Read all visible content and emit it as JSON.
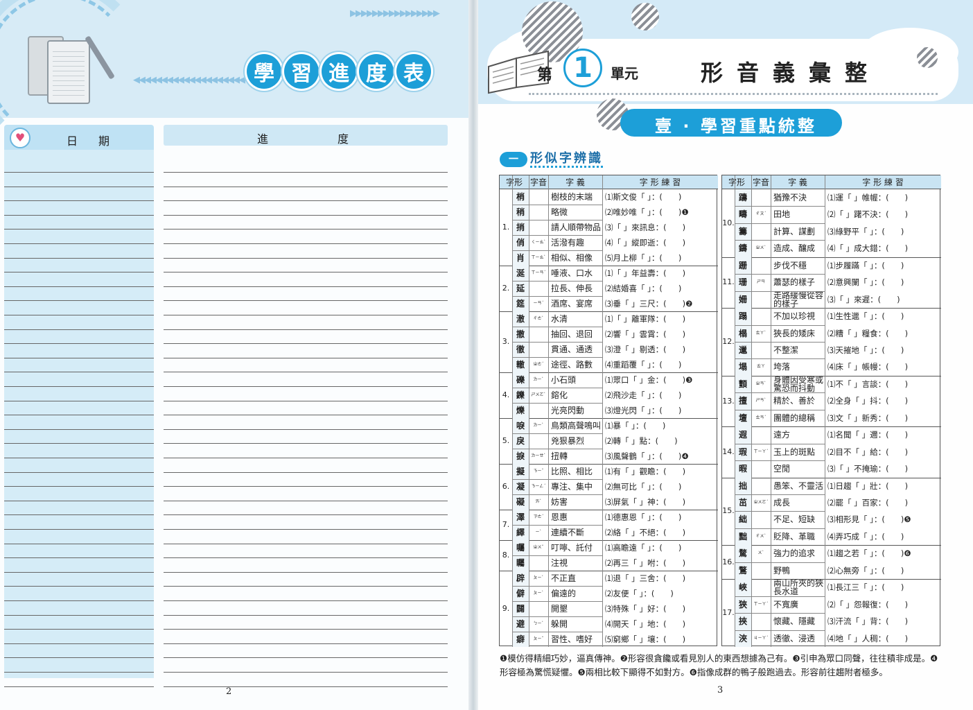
{
  "left_page": {
    "title_chars": [
      "學",
      "習",
      "進",
      "度",
      "表"
    ],
    "date_header": "日期",
    "progress_header": "進度",
    "page_number": "2"
  },
  "right_page": {
    "unit": {
      "di": "第",
      "number": "1",
      "yuan": "單元"
    },
    "unit_title": "形音義彙整",
    "section_title": "壹 · 學習重點統整",
    "subsection_num": "一",
    "subsection_title": "形似字辨識",
    "table_headers": [
      "字形",
      "字音",
      "字 義",
      "字 形 練 習"
    ],
    "left_table": [
      {
        "no": "1.",
        "rows": [
          [
            "梢",
            "",
            "樹枝的末端"
          ],
          [
            "稍",
            "",
            "略微"
          ],
          [
            "捎",
            "",
            "請人順帶物品"
          ],
          [
            "俏",
            "ㄑㄧㄠˋ",
            "活潑有趣"
          ],
          [
            "肖",
            "ㄒㄧㄠˋ",
            "相似、相像"
          ]
        ],
        "practice": [
          "⑴斯文俊「 」：(　　)",
          "⑵唯妙唯「 」：(　　)❶",
          "⑶「 」來訊息：(　　)",
          "⑷「 」縱即逝：(　　)",
          "⑸月上柳「 」：(　　)"
        ]
      },
      {
        "no": "2.",
        "rows": [
          [
            "涎",
            "ㄒㄧㄢˊ",
            "唾液、口水"
          ],
          [
            "延",
            "",
            "拉長、伸長"
          ],
          [
            "筵",
            "ㄧㄢˊ",
            "酒席、宴席"
          ]
        ],
        "practice": [
          "⑴「 」年益壽：(　　)",
          "⑵結婚喜「 」：(　　)",
          "⑶垂「 」三尺：(　　)❷"
        ]
      },
      {
        "no": "3.",
        "rows": [
          [
            "澈",
            "ㄔㄜˋ",
            "水清"
          ],
          [
            "撤",
            "",
            "抽回、退回"
          ],
          [
            "徹",
            "",
            "貫通、通透"
          ],
          [
            "轍",
            "ㄓㄜˊ",
            "途徑、路數"
          ]
        ],
        "practice": [
          "⑴「 」離軍隊：(　　)",
          "⑵響「 」雲霄：(　　)",
          "⑶澄「 」剔透：(　　)",
          "⑷重蹈覆「 」：(　　)"
        ]
      },
      {
        "no": "4.",
        "rows": [
          [
            "礫",
            "ㄌㄧˋ",
            "小石頭"
          ],
          [
            "鑠",
            "ㄕㄨㄛˋ",
            "鎔化"
          ],
          [
            "爍",
            "",
            "光亮閃動"
          ]
        ],
        "practice": [
          "⑴眾口「 」金：(　　)❸",
          "⑵飛沙走「 」：(　　)",
          "⑶燈光閃「 」：(　　)"
        ]
      },
      {
        "no": "5.",
        "rows": [
          [
            "唳",
            "ㄌㄧˋ",
            "鳥類高聲鳴叫"
          ],
          [
            "戾",
            "",
            "兇狠暴烈"
          ],
          [
            "捩",
            "ㄌㄧㄝˋ",
            "扭轉"
          ]
        ],
        "practice": [
          "⑴暴「 」：(　　)",
          "⑵轉「 」點：(　　)",
          "⑶風聲鶴「 」：(　　)❹"
        ]
      },
      {
        "no": "6.",
        "rows": [
          [
            "擬",
            "ㄋㄧˇ",
            "比照、相比"
          ],
          [
            "凝",
            "ㄋㄧㄥˊ",
            "專注、集中"
          ],
          [
            "礙",
            "ㄞˋ",
            "妨害"
          ]
        ],
        "practice": [
          "⑴有「 」觀瞻：(　　)",
          "⑵無可比「 」：(　　)",
          "⑶屏氣「 」神：(　　)"
        ]
      },
      {
        "no": "7.",
        "rows": [
          [
            "澤",
            "ㄗㄜˊ",
            "恩惠"
          ],
          [
            "繹",
            "ㄧˋ",
            "連續不斷"
          ]
        ],
        "practice": [
          "⑴德惠恩「 」：(　　)",
          "⑵絡「 」不絕：(　　)"
        ]
      },
      {
        "no": "8.",
        "rows": [
          [
            "囑",
            "ㄓㄨˇ",
            "叮嚀、託付"
          ],
          [
            "矚",
            "",
            "注視"
          ]
        ],
        "practice": [
          "⑴高瞻遠「 」：(　　)",
          "⑵再三「 」咐：(　　)"
        ]
      },
      {
        "no": "9.",
        "rows": [
          [
            "辟",
            "ㄆㄧˋ",
            "不正直"
          ],
          [
            "僻",
            "ㄆㄧˋ",
            "偏遠的"
          ],
          [
            "闢",
            "",
            "開墾"
          ],
          [
            "避",
            "ㄅㄧˋ",
            "躲開"
          ],
          [
            "癖",
            "ㄆㄧˇ",
            "習性、嗜好"
          ]
        ],
        "practice": [
          "⑴退「 」三舍：(　　)",
          "⑵友便「 」：(　　)",
          "⑶特殊「 」好：(　　)",
          "⑷開天「 」地：(　　)",
          "⑸窮鄉「 」壤：(　　)"
        ]
      }
    ],
    "right_table": [
      {
        "no": "10.",
        "rows": [
          [
            "躊",
            "",
            "猶豫不決"
          ],
          [
            "疇",
            "ㄔㄡˊ",
            "田地"
          ],
          [
            "籌",
            "",
            "計算、謀劃"
          ],
          [
            "鑄",
            "ㄓㄨˋ",
            "造成、釀成"
          ]
        ],
        "practice": [
          "⑴運「 」帷幄：(　　)",
          "⑵「 」躇不決：(　　)",
          "⑶綠野平「 」：(　　)",
          "⑷「 」成大錯：(　　)"
        ]
      },
      {
        "no": "11.",
        "rows": [
          [
            "跚",
            "",
            "步伐不穩"
          ],
          [
            "珊",
            "ㄕㄢ",
            "蕭瑟的樣子"
          ],
          [
            "姍",
            "",
            "走路緩慢從容的樣子"
          ]
        ],
        "practice": [
          "⑴步履蹣「 」：(　　)",
          "⑵意興闌「 」：(　　)",
          "⑶「 」來遲：(　　)"
        ]
      },
      {
        "no": "12.",
        "rows": [
          [
            "蹋",
            "",
            "不加以珍視"
          ],
          [
            "榻",
            "ㄊㄚˋ",
            "狹長的矮床"
          ],
          [
            "邋",
            "",
            "不整潔"
          ],
          [
            "塌",
            "ㄊㄚ",
            "垮落"
          ]
        ],
        "practice": [
          "⑴生性邋「 」：(　　)",
          "⑵糟「 」糧食：(　　)",
          "⑶天摧地「 」：(　　)",
          "⑷床「 」帳幔：(　　)"
        ]
      },
      {
        "no": "13.",
        "rows": [
          [
            "顫",
            "ㄓㄢˋ",
            "身體因受寒或驚恐而抖動"
          ],
          [
            "擅",
            "ㄕㄢˋ",
            "精於、善於"
          ],
          [
            "壇",
            "ㄊㄢˊ",
            "團體的總稱"
          ]
        ],
        "practice": [
          "⑴不「 」言談：(　　)",
          "⑵全身「 」抖：(　　)",
          "⑶文「 」新秀：(　　)"
        ]
      },
      {
        "no": "14.",
        "rows": [
          [
            "遐",
            "",
            "遠方"
          ],
          [
            "瑕",
            "ㄒㄧㄚˊ",
            "玉上的斑點"
          ],
          [
            "暇",
            "",
            "空閒"
          ]
        ],
        "practice": [
          "⑴名聞「 」邇：(　　)",
          "⑵目不「 」給：(　　)",
          "⑶「 」不掩瑜：(　　)"
        ]
      },
      {
        "no": "15.",
        "rows": [
          [
            "拙",
            "",
            "愚笨、不靈活"
          ],
          [
            "茁",
            "ㄓㄨㄛˊ",
            "成長"
          ],
          [
            "絀",
            "",
            "不足、短缺"
          ],
          [
            "黜",
            "ㄔㄨˋ",
            "貶降、革職"
          ]
        ],
        "practice": [
          "⑴日趨「 」壯：(　　)",
          "⑵罷「 」百家：(　　)",
          "⑶相形見「 」：(　　)❺",
          "⑷弄巧成「 」：(　　)"
        ]
      },
      {
        "no": "16.",
        "rows": [
          [
            "騖",
            "ㄨˋ",
            "強力的追求"
          ],
          [
            "鶩",
            "",
            "野鴨"
          ]
        ],
        "practice": [
          "⑴趨之若「 」：(　　)❻",
          "⑵心無旁「 」：(　　)"
        ]
      },
      {
        "no": "17.",
        "rows": [
          [
            "峽",
            "",
            "兩山所夾的狹長水道"
          ],
          [
            "狹",
            "ㄒㄧㄚˊ",
            "不寬廣"
          ],
          [
            "挾",
            "",
            "懷藏、隱藏"
          ],
          [
            "浹",
            "ㄐㄧㄚˊ",
            "透徹、浸透"
          ]
        ],
        "practice": [
          "⑴長江三「 」：(　　)",
          "⑵「 」怨報復：(　　)",
          "⑶汗流「 」背：(　　)",
          "⑷地「 」人稠：(　　)"
        ]
      }
    ],
    "footnote": "❶模仿得精細巧妙，逼真傳神。❷形容很貪饞或看見別人的東西想據為己有。❸引申為眾口同聲，往往積非成是。❹形容極為驚慌疑懼。❺兩相比較下顯得不如對方。❻指像成群的鴨子般跑過去。形容前往趨附者極多。",
    "page_number": "3"
  },
  "colors": {
    "accent": "#1d9fd8",
    "header_bg": "#d4eaf7",
    "table_header": "#c9e4f3"
  }
}
